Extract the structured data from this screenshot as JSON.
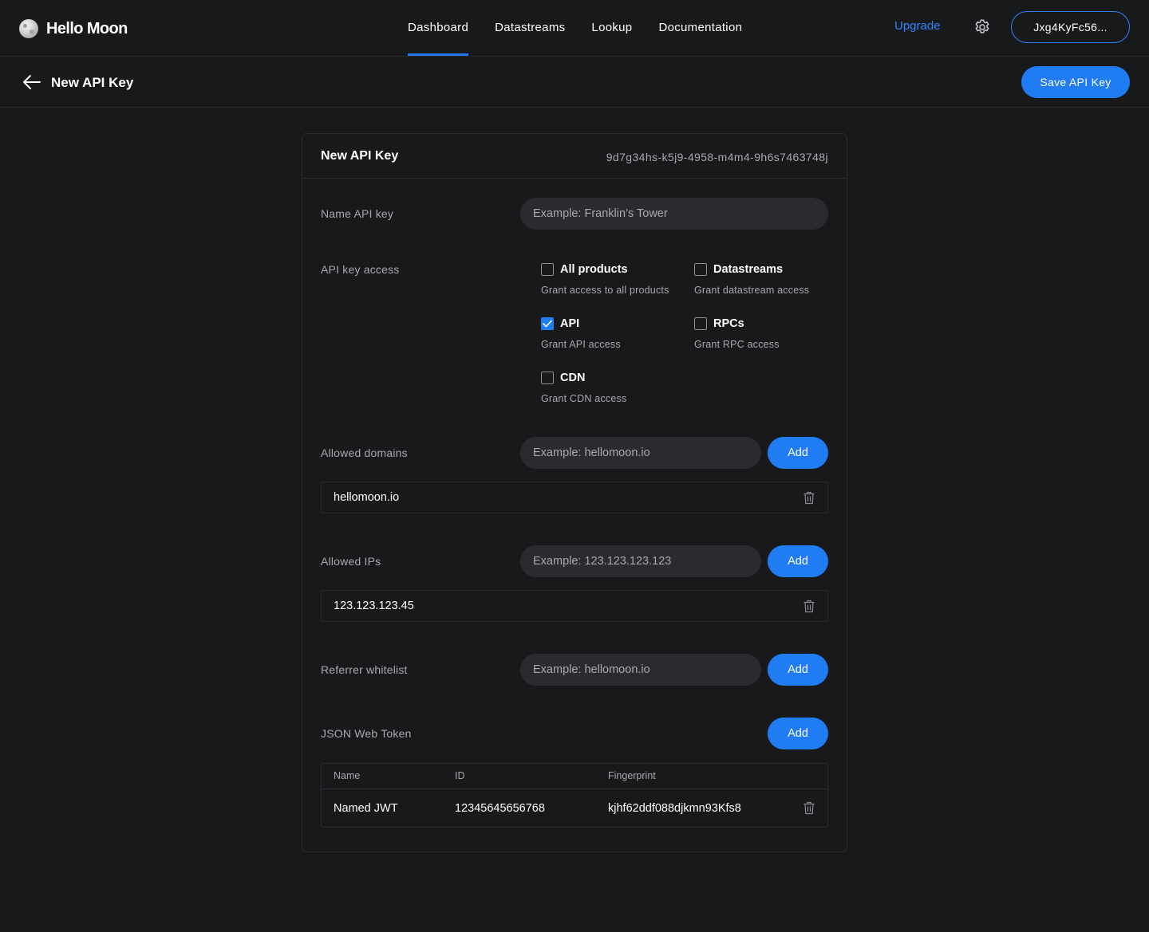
{
  "brand": {
    "name": "Hello Moon",
    "logo_icon": "moon-icon"
  },
  "nav": {
    "links": [
      {
        "label": "Dashboard",
        "active": true
      },
      {
        "label": "Datastreams",
        "active": false
      },
      {
        "label": "Lookup",
        "active": false
      },
      {
        "label": "Documentation",
        "active": false
      }
    ],
    "upgrade_label": "Upgrade",
    "settings_icon": "gear-icon",
    "wallet_label": "Jxg4KyFc56..."
  },
  "subheader": {
    "back_icon": "arrow-left-icon",
    "title": "New API Key",
    "save_label": "Save API Key"
  },
  "card": {
    "title": "New API Key",
    "key_id": "9d7g34hs-k5j9-4958-m4m4-9h6s7463748j",
    "name_field": {
      "label": "Name API key",
      "placeholder": "Example: Franklin’s Tower",
      "value": ""
    },
    "access": {
      "label": "API key access",
      "options": [
        {
          "label": "All products",
          "description": "Grant access to all products",
          "checked": false
        },
        {
          "label": "Datastreams",
          "description": "Grant datastream access",
          "checked": false
        },
        {
          "label": "API",
          "description": "Grant API access",
          "checked": true
        },
        {
          "label": "RPCs",
          "description": "Grant RPC access",
          "checked": false
        },
        {
          "label": "CDN",
          "description": "Grant CDN access",
          "checked": false
        }
      ]
    },
    "domains": {
      "label": "Allowed domains",
      "placeholder": "Example: hellomoon.io",
      "add_label": "Add",
      "items": [
        "hellomoon.io"
      ]
    },
    "ips": {
      "label": "Allowed IPs",
      "placeholder": "Example: 123.123.123.123",
      "add_label": "Add",
      "items": [
        "123.123.123.45"
      ]
    },
    "referrer": {
      "label": "Referrer whitelist",
      "placeholder": "Example: hellomoon.io",
      "add_label": "Add"
    },
    "jwt": {
      "label": "JSON Web Token",
      "add_label": "Add",
      "columns": [
        "Name",
        "ID",
        "Fingerprint"
      ],
      "rows": [
        {
          "name": "Named JWT",
          "id": "12345645656768",
          "fingerprint": "kjhf62ddf088djkmn93Kfs8"
        }
      ]
    },
    "delete_icon": "trash-icon"
  },
  "colors": {
    "background": "#18191b",
    "accent": "#1f7cf2",
    "link": "#2b86ff",
    "border": "#2a2b2e",
    "muted_text": "#a7a9ad"
  }
}
